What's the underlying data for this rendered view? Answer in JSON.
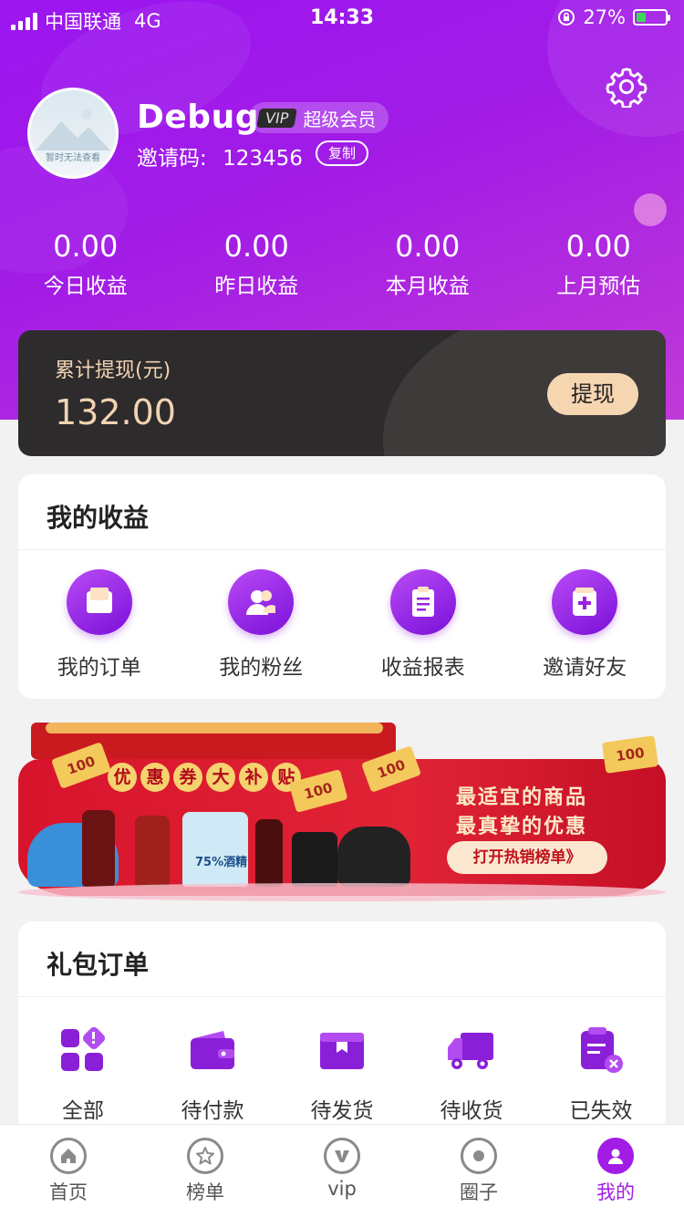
{
  "status_bar": {
    "carrier": "中国联通",
    "network": "4G",
    "time": "14:33",
    "battery": "27%"
  },
  "profile": {
    "avatar_text": "暂时无法查看",
    "username": "Debug",
    "vip_tag": "VIP",
    "vip_level": "超级会员",
    "invite_label": "邀请码:",
    "invite_code": "123456",
    "copy_label": "复制"
  },
  "stats": [
    {
      "value": "0.00",
      "label": "今日收益"
    },
    {
      "value": "0.00",
      "label": "昨日收益"
    },
    {
      "value": "0.00",
      "label": "本月收益"
    },
    {
      "value": "0.00",
      "label": "上月预估"
    }
  ],
  "withdraw": {
    "label": "累计提现(元)",
    "amount": "132.00",
    "button": "提现"
  },
  "earnings_section": {
    "title": "我的收益",
    "items": [
      {
        "label": "我的订单",
        "icon": "order-icon"
      },
      {
        "label": "我的粉丝",
        "icon": "fans-icon"
      },
      {
        "label": "收益报表",
        "icon": "report-icon"
      },
      {
        "label": "邀请好友",
        "icon": "invite-icon"
      }
    ]
  },
  "banner": {
    "headline_chars": [
      "优",
      "惠",
      "券",
      "大",
      "补",
      "贴"
    ],
    "coupon_text": "100",
    "goods_label": "75%酒精",
    "line1": "最适宜的商品",
    "line2": "最真挚的优惠",
    "button": "打开热销榜单》"
  },
  "gift_orders": {
    "title": "礼包订单",
    "items": [
      {
        "label": "全部",
        "icon": "all-orders-icon"
      },
      {
        "label": "待付款",
        "icon": "wallet-icon"
      },
      {
        "label": "待发货",
        "icon": "package-icon"
      },
      {
        "label": "待收货",
        "icon": "truck-icon"
      },
      {
        "label": "已失效",
        "icon": "expired-icon"
      }
    ]
  },
  "tab_bar": {
    "items": [
      {
        "label": "首页",
        "icon": "home-icon"
      },
      {
        "label": "榜单",
        "icon": "star-icon"
      },
      {
        "label": "vip",
        "icon": "vip-icon"
      },
      {
        "label": "圈子",
        "icon": "circle-icon"
      },
      {
        "label": "我的",
        "icon": "user-icon",
        "active": true
      }
    ]
  },
  "colors": {
    "brand_purple": "#a21ce6",
    "card_dark": "#2d2b2c",
    "gold_text": "#f1d3b2",
    "banner_red": "#d8142c"
  }
}
